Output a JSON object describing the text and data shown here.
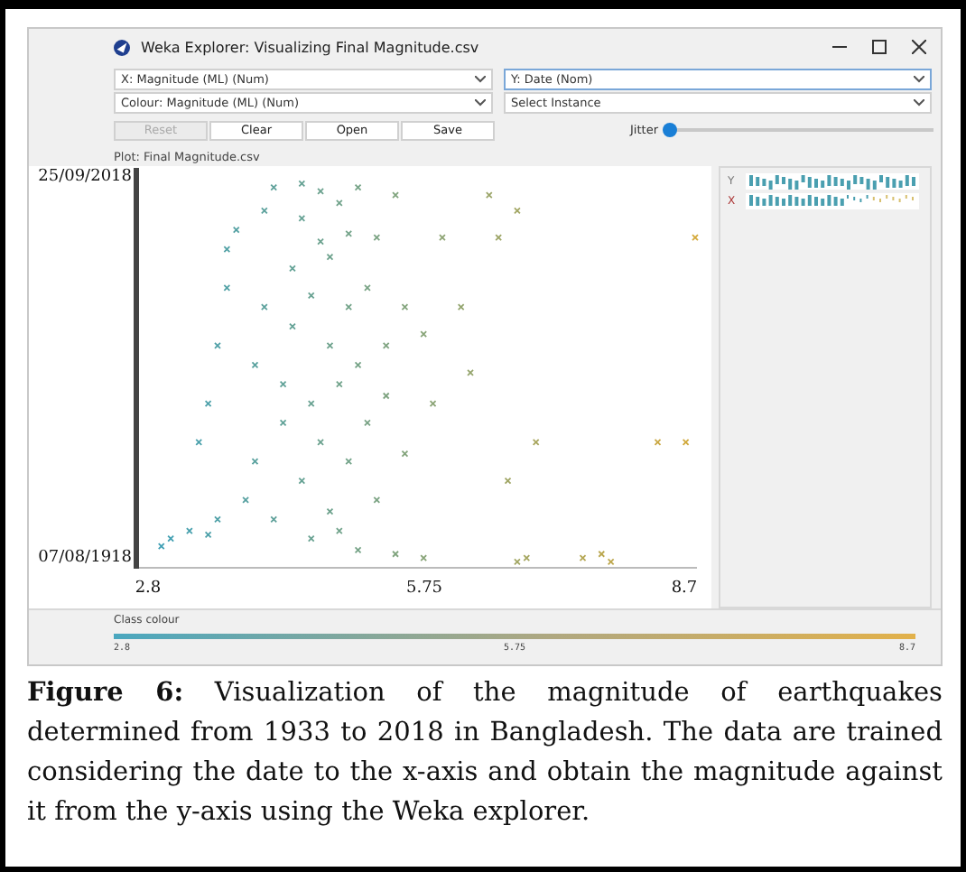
{
  "window": {
    "title": "Weka Explorer: Visualizing Final Magnitude.csv"
  },
  "selectors": [
    {
      "label": "X: Magnitude (ML) (Num)",
      "highlighted": false
    },
    {
      "label": "Y: Date (Nom)",
      "highlighted": true
    },
    {
      "label": "Colour: Magnitude (ML) (Num)",
      "highlighted": false
    },
    {
      "label": "Select Instance",
      "highlighted": false
    }
  ],
  "buttons": [
    {
      "label": "Reset",
      "disabled": true
    },
    {
      "label": "Clear",
      "disabled": false
    },
    {
      "label": "Open",
      "disabled": false
    },
    {
      "label": "Save",
      "disabled": false
    }
  ],
  "jitter": {
    "label": "Jitter",
    "level": 0
  },
  "plot": {
    "title": "Plot: Final Magnitude.csv",
    "y_axis_labels": [
      "25/09/2018",
      "07/08/1918"
    ],
    "x_axis_labels": [
      "2.8",
      "5.75",
      "8.7"
    ]
  },
  "attribute_strips": [
    {
      "label": "Y"
    },
    {
      "label": "X"
    }
  ],
  "class_colour": {
    "label": "Class colour",
    "ticks": [
      "2.8",
      "5.75",
      "8.7"
    ]
  },
  "caption": "**Figure 6:** Visualization of the magnitude of earthquakes determined from 1933 to 2018 in Bangladesh. The data are trained considering the date to the x-axis and obtain the magnitude against it from the y-axis using the Weka explorer."
}
